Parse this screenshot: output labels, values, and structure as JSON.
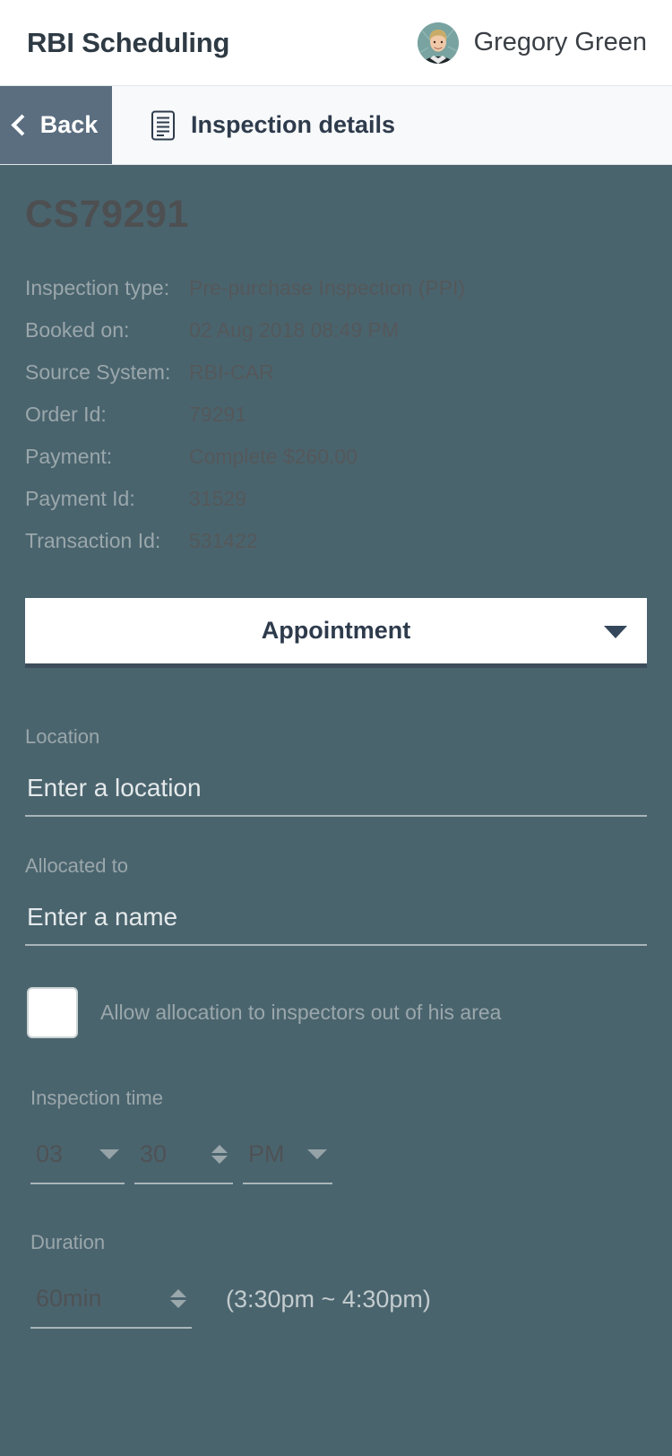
{
  "appbar": {
    "title": "RBI Scheduling",
    "user_name": "Gregory Green",
    "avatar_icon": "user-avatar-photo"
  },
  "subbar": {
    "back_label": "Back",
    "back_icon": "chevron-left-icon",
    "breadcrumb_label": "Inspection details",
    "breadcrumb_icon": "document-icon"
  },
  "record": {
    "id": "CS79291",
    "details": [
      {
        "label": "Inspection type:",
        "value": "Pre-purchase Inspection (PPI)"
      },
      {
        "label": "Booked on:",
        "value": "02 Aug 2018 08:49 PM"
      },
      {
        "label": "Source System:",
        "value": "RBI-CAR"
      },
      {
        "label": "Order Id:",
        "value": "79291"
      },
      {
        "label": "Payment:",
        "value": "Complete $260.00"
      },
      {
        "label": "Payment Id:",
        "value": "31529"
      },
      {
        "label": "Transaction Id:",
        "value": "531422"
      }
    ]
  },
  "appointment_select": {
    "value": "Appointment",
    "caret_icon": "caret-down-icon"
  },
  "location_field": {
    "label": "Location",
    "value": "",
    "placeholder": "Enter a location"
  },
  "allocated_field": {
    "label": "Allocated to",
    "value": "",
    "placeholder": "Enter a name"
  },
  "allow_allocation": {
    "label": "Allow allocation to inspectors out of his area",
    "checked": false
  },
  "inspection_time": {
    "label": "Inspection time",
    "hour": "03",
    "minute": "30",
    "meridiem": "PM",
    "hour_icon": "caret-down-icon",
    "minute_icon": "spinner-up-down-icon",
    "meridiem_icon": "caret-down-icon"
  },
  "duration": {
    "label": "Duration",
    "value": "60min",
    "spinner_icon": "spinner-up-down-icon",
    "range": "(3:30pm ~ 4:30pm)"
  },
  "colors": {
    "page_background": "#4a646e",
    "appbar_background": "#ffffff",
    "back_button": "#5b6e80",
    "accent_dark": "#2e3b4c",
    "muted_text": "#9aa7ab",
    "value_text": "#54585a"
  }
}
